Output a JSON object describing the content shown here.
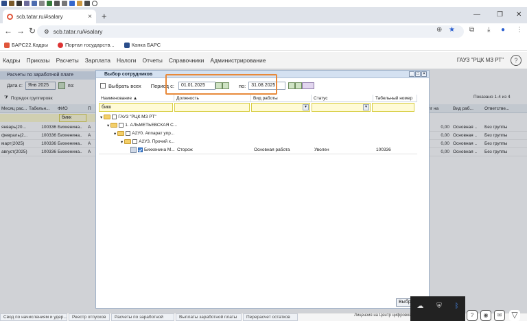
{
  "browser": {
    "tab_title": "scb.tatar.ru/#salary",
    "url": "scb.tatar.ru/#salary",
    "bookmarks": [
      "БАРС22.Кадры",
      "Портал государств...",
      "Канка БАРС"
    ]
  },
  "menu": {
    "items": [
      "Кадры",
      "Приказы",
      "Расчеты",
      "Зарплата",
      "Налоги",
      "Отчеты",
      "Справочники",
      "Администрирование"
    ],
    "org": "ГАУЗ \"РЦК МЗ РТ\"",
    "help": "?"
  },
  "bg": {
    "panel_title": "Расчеты по заработной плате",
    "date_label": "Дата с:",
    "date_value": "Янв 2025",
    "date_to": "по:",
    "group_label": "Порядок группировк",
    "shown": "Показано 1-4 из 4",
    "headers": [
      "Месяц рас...",
      "Табельн...",
      "ФИО",
      "П"
    ],
    "filter_fio": "бикк",
    "rows": [
      [
        "январь(20...",
        "100336",
        "Бихкенина..",
        "А"
      ],
      [
        "февраль(2...",
        "100336",
        "Бихкенина..",
        "А"
      ],
      [
        "март(2025)",
        "100336",
        "Бихкенина..",
        "А"
      ],
      [
        "август(2025)",
        "100336",
        "Бихкенина..",
        "А"
      ]
    ],
    "right_headers": [
      "лг на",
      "Вид раб...",
      "Ответстве..."
    ],
    "right_rows": [
      [
        "0,00",
        "Основная ..",
        "Без группы"
      ],
      [
        "0,00",
        "Основная ..",
        "Без группы"
      ],
      [
        "0,00",
        "Основная ..",
        "Без группы"
      ],
      [
        "0,00",
        "Основная ..",
        "Без группы"
      ]
    ]
  },
  "dialog": {
    "title": "Выбор сотрудников",
    "select_all": "Выбрать всех",
    "period_label": "Период с:",
    "date_from": "01.01.2025",
    "to_label": "по:",
    "date_to": "31.08.2025",
    "columns": [
      "Наименование ▲",
      "Должность",
      "Вид работы",
      "Статус",
      "Табельный номер"
    ],
    "filter_name": "бикк",
    "tree": [
      "ГАУЗ \"РЦК МЗ РТ\"",
      "1. АЛЬМЕТЬЕВСКАЯ С...",
      "А2У0. Аппарат упр...",
      "А2У3. Прочий х..."
    ],
    "leaf": {
      "name": "Бихкенина М...",
      "position": "Сторож",
      "work_type": "Основная работа",
      "status": "Уволен",
      "tab_number": "100336"
    },
    "choose": "Выбр"
  },
  "taskbar": {
    "items": [
      "Свод по начислениям и удер...",
      "Реестр отпусков",
      "Расчеты по заработной",
      "Выплаты заработной платы",
      "Перерасчет остатков"
    ],
    "license": "Лицензия на",
    "center": "Центр цифровой трансфор"
  }
}
